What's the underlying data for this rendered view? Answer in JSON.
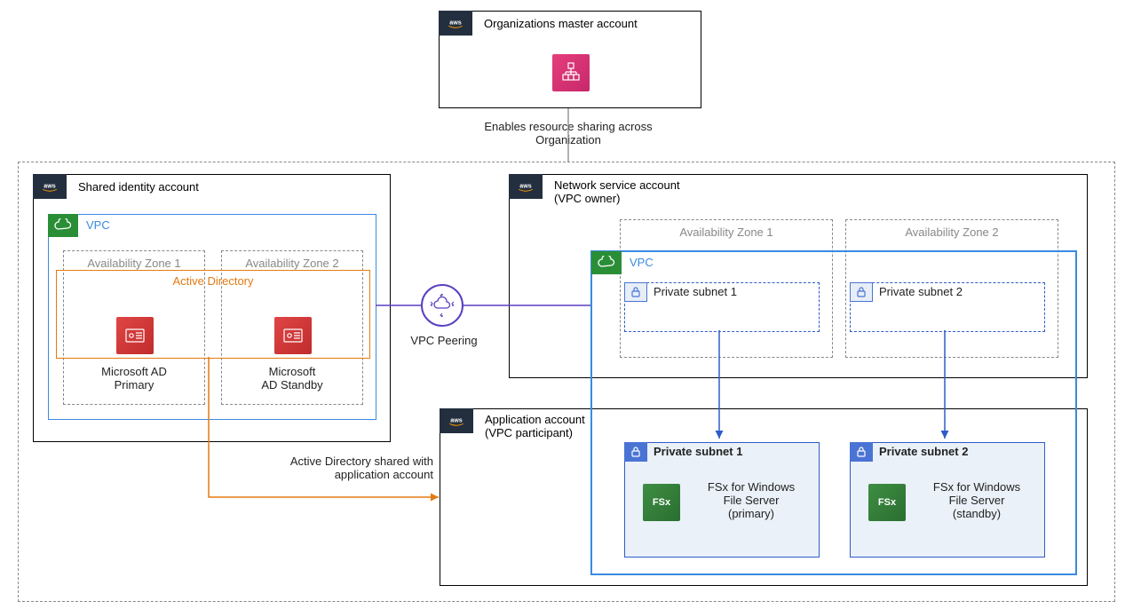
{
  "master_account": {
    "title": "Organizations master account",
    "caption": "Enables resource sharing across Organization"
  },
  "identity_account": {
    "title": "Shared identity account",
    "vpc_label": "VPC",
    "az1": "Availability Zone 1",
    "az2": "Availability Zone 2",
    "active_directory": "Active Directory",
    "ad_primary_1": "Microsoft AD",
    "ad_primary_2": "Primary",
    "ad_standby_1": "Microsoft",
    "ad_standby_2": "AD Standby",
    "shared_caption": "Active Directory shared with application account"
  },
  "network_account": {
    "title_1": "Network service account",
    "title_2": "(VPC owner)",
    "vpc_label": "VPC",
    "az1": "Availability Zone 1",
    "az2": "Availability Zone 2",
    "subnet1": "Private subnet 1",
    "subnet2": "Private subnet 2"
  },
  "application_account": {
    "title_1": "Application account",
    "title_2": "(VPC participant)",
    "subnet1": "Private subnet 1",
    "subnet2": "Private subnet 2",
    "fsx_primary_1": "FSx for Windows",
    "fsx_primary_2": "File Server",
    "fsx_primary_3": "(primary)",
    "fsx_standby_1": "FSx for Windows",
    "fsx_standby_2": "File Server",
    "fsx_standby_3": "(standby)"
  },
  "peering_label": "VPC Peering",
  "icon_labels": {
    "fsx": "FSx"
  }
}
